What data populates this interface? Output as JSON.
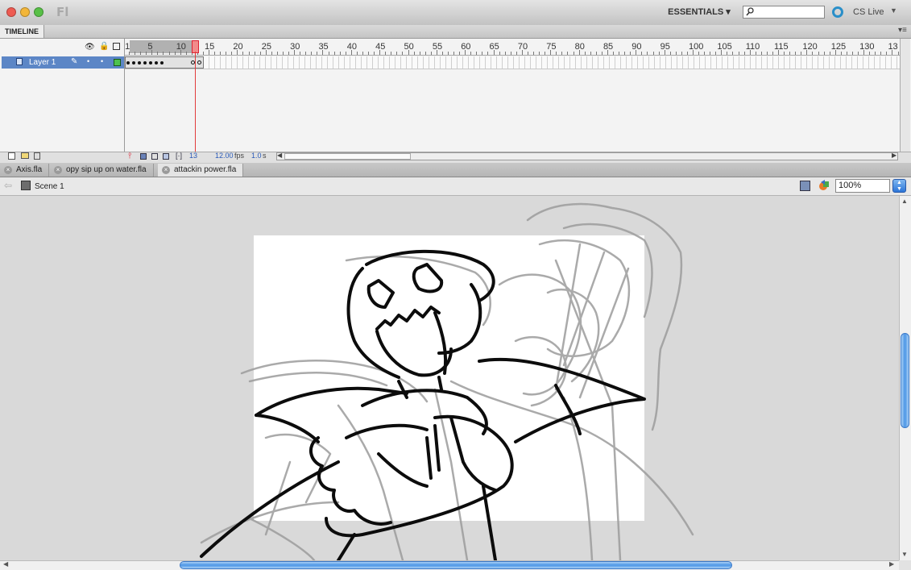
{
  "app": {
    "logo_text": "Fl",
    "workspace": "ESSENTIALS",
    "search": {
      "value": "",
      "placeholder": ""
    },
    "cs_live": "CS Live"
  },
  "timeline": {
    "tab_label": "TIMELINE",
    "ruler_labels": [
      "1",
      "5",
      "10",
      "15",
      "20",
      "25",
      "30",
      "35",
      "40",
      "45",
      "50",
      "55",
      "60",
      "65",
      "70",
      "75",
      "80",
      "85",
      "90",
      "95",
      "100",
      "105",
      "110",
      "115",
      "120",
      "125",
      "130",
      "13"
    ],
    "layer_name": "Layer 1",
    "current_frame": "13",
    "fps_value": "12.00",
    "fps_unit": "fps",
    "time_value": "1.0",
    "time_unit": "s"
  },
  "documents": {
    "tabs": [
      {
        "label": "Axis.fla",
        "active": false
      },
      {
        "label": "opy sip up on water.fla",
        "active": false
      },
      {
        "label": "attackin power.fla",
        "active": true
      }
    ]
  },
  "editbar": {
    "scene": "Scene 1",
    "zoom": "100%"
  },
  "colors": {
    "layer_highlight": "#5c86c6",
    "playhead": "#e23b3b",
    "scroll_thumb": "#4c96e6",
    "stage": "#ffffff",
    "pasteboard": "#d9d9d9"
  }
}
